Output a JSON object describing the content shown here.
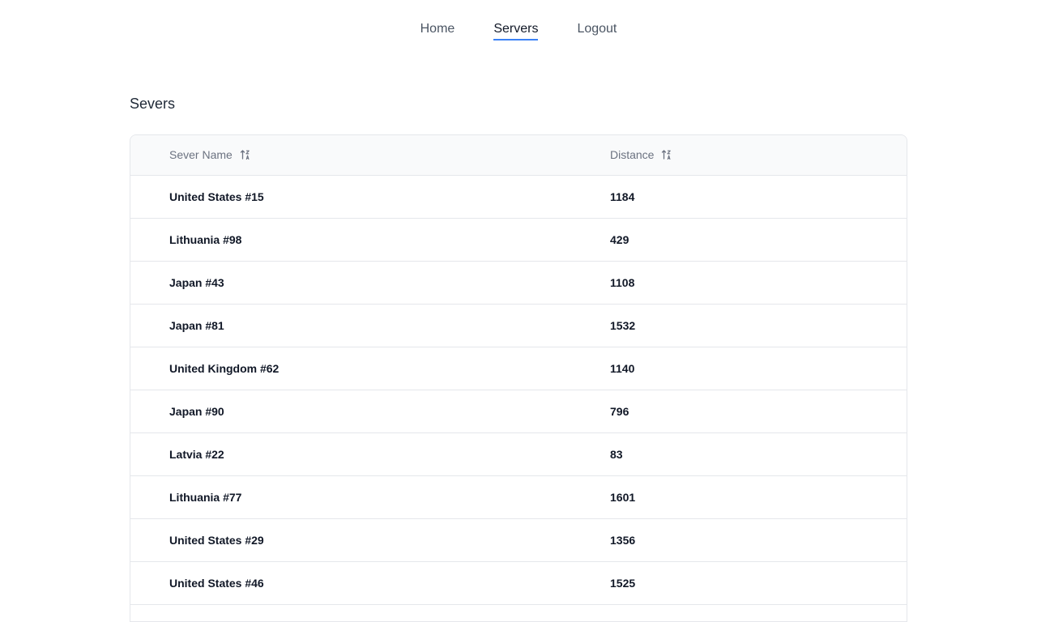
{
  "nav": {
    "items": [
      {
        "label": "Home",
        "active": false
      },
      {
        "label": "Servers",
        "active": true
      },
      {
        "label": "Logout",
        "active": false
      }
    ],
    "accent_color": "#3b82f6"
  },
  "page": {
    "title": "Severs"
  },
  "table": {
    "columns": [
      {
        "label": "Sever Name",
        "icon": "sort-icon"
      },
      {
        "label": "Distance",
        "icon": "sort-icon"
      }
    ],
    "rows": [
      {
        "name": "United States #15",
        "distance": "1184"
      },
      {
        "name": "Lithuania #98",
        "distance": "429"
      },
      {
        "name": "Japan #43",
        "distance": "1108"
      },
      {
        "name": "Japan #81",
        "distance": "1532"
      },
      {
        "name": "United Kingdom #62",
        "distance": "1140"
      },
      {
        "name": "Japan #90",
        "distance": "796"
      },
      {
        "name": "Latvia #22",
        "distance": "83"
      },
      {
        "name": "Lithuania #77",
        "distance": "1601"
      },
      {
        "name": "United States #29",
        "distance": "1356"
      },
      {
        "name": "United States #46",
        "distance": "1525"
      }
    ]
  }
}
